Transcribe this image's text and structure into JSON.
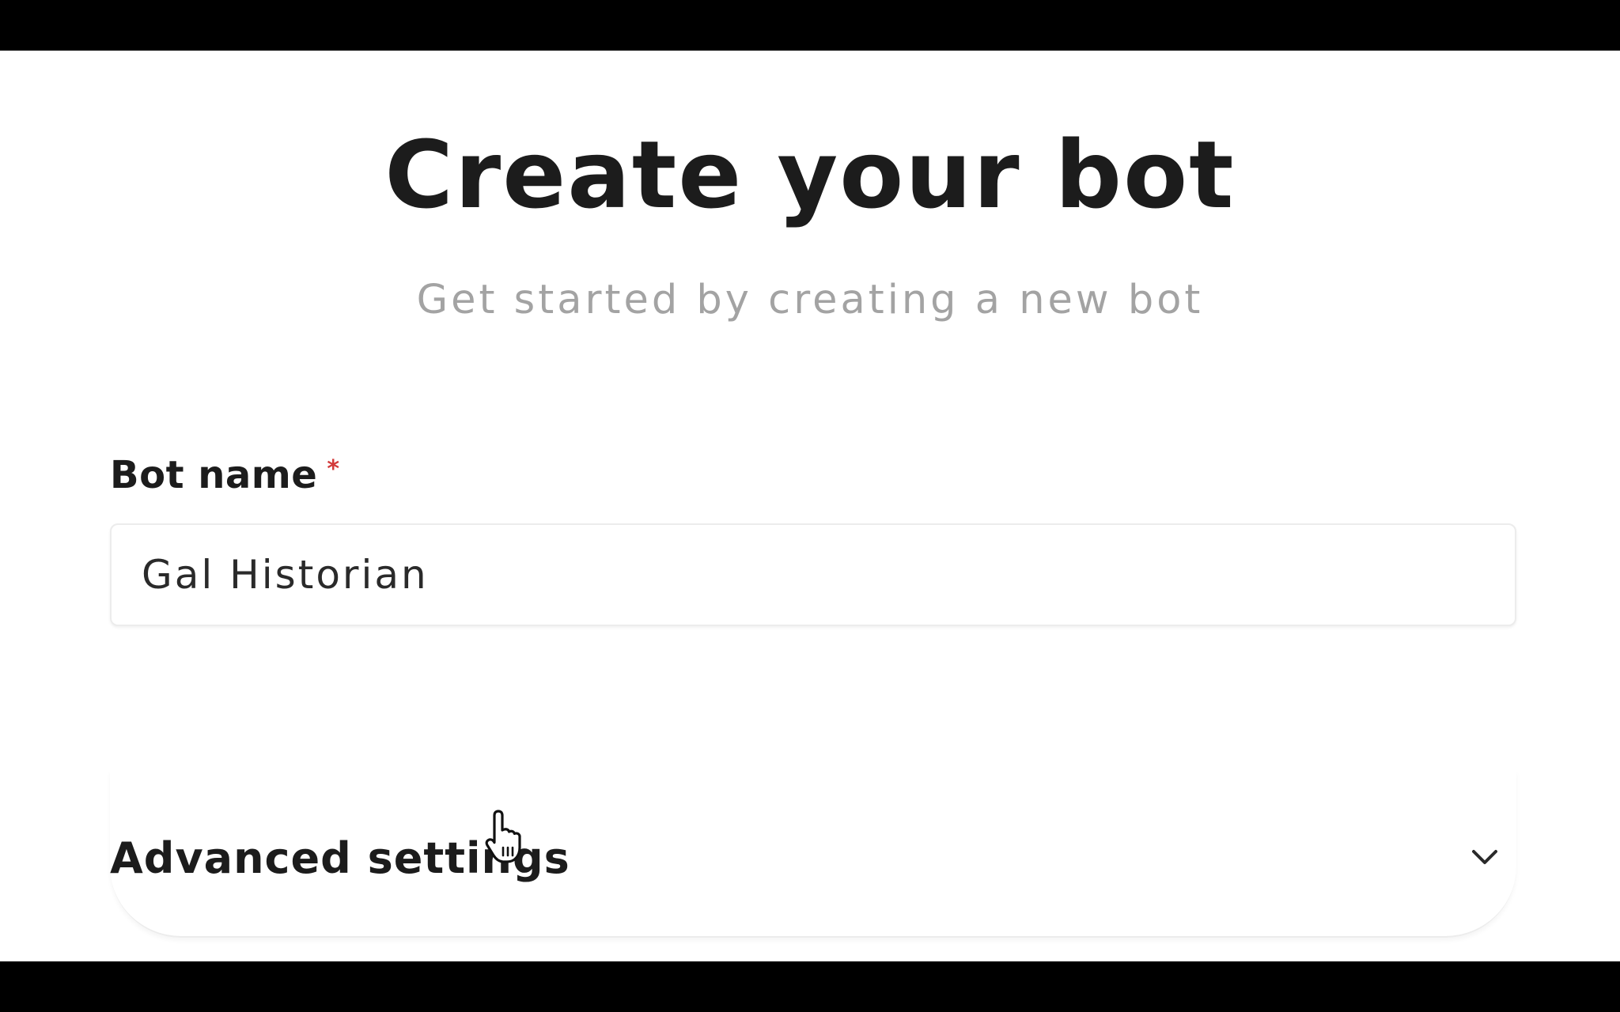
{
  "header": {
    "title": "Create your bot",
    "subtitle": "Get started by creating a new bot"
  },
  "form": {
    "bot_name": {
      "label": "Bot name",
      "required_marker": "*",
      "value": "Gal Historian"
    },
    "advanced": {
      "label": "Advanced settings",
      "icon": "chevron-down-icon",
      "expanded": false
    }
  },
  "colors": {
    "text": "#1c1c1c",
    "muted": "#a3a3a3",
    "required": "#d23a3a",
    "border": "#ececec"
  }
}
